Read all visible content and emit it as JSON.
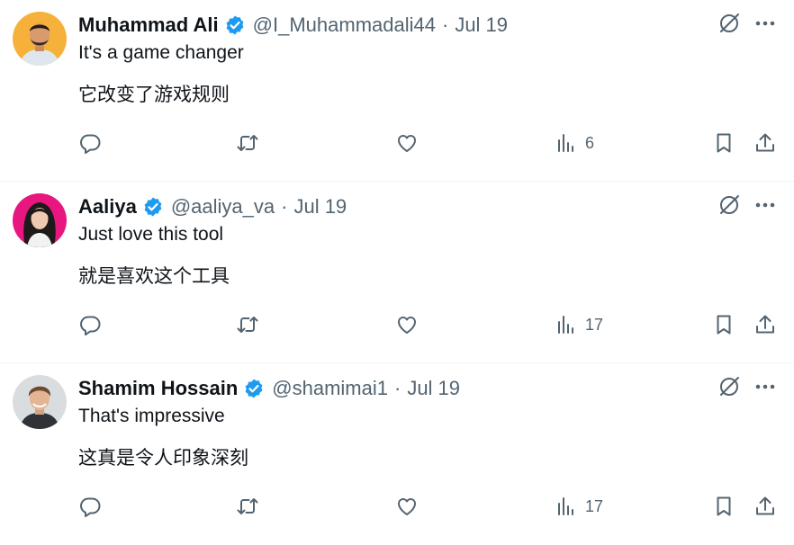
{
  "colors": {
    "verified": "#1d9bf0",
    "secondary_text": "#536471",
    "primary_text": "#0f1419",
    "divider": "#eff3f4"
  },
  "icons": {
    "reply": "speech-bubble-icon",
    "retweet": "retweet-arrows-icon",
    "like": "heart-icon",
    "views": "bar-chart-icon",
    "bookmark": "bookmark-icon",
    "share": "share-upload-icon",
    "grok": "grok-slash-circle-icon",
    "more": "ellipsis-icon"
  },
  "tweets": [
    {
      "name": "Muhammad Ali",
      "handle": "@I_Muhammadali44",
      "separator": "·",
      "time": "Jul 19",
      "text_en": "It's a game changer",
      "text_zh": "它改变了游戏规则",
      "views": "6",
      "avatar_bg": "#f6b13b"
    },
    {
      "name": "Aaliya",
      "handle": "@aaliya_va",
      "separator": "·",
      "time": "Jul 19",
      "text_en": "Just love this tool",
      "text_zh": "就是喜欢这个工具",
      "views": "17",
      "avatar_bg": "#e8177f"
    },
    {
      "name": "Shamim Hossain",
      "handle": "@shamimai1",
      "separator": "·",
      "time": "Jul 19",
      "text_en": "That's impressive",
      "text_zh": "这真是令人印象深刻",
      "views": "17",
      "avatar_bg": "#d9dde0"
    }
  ]
}
